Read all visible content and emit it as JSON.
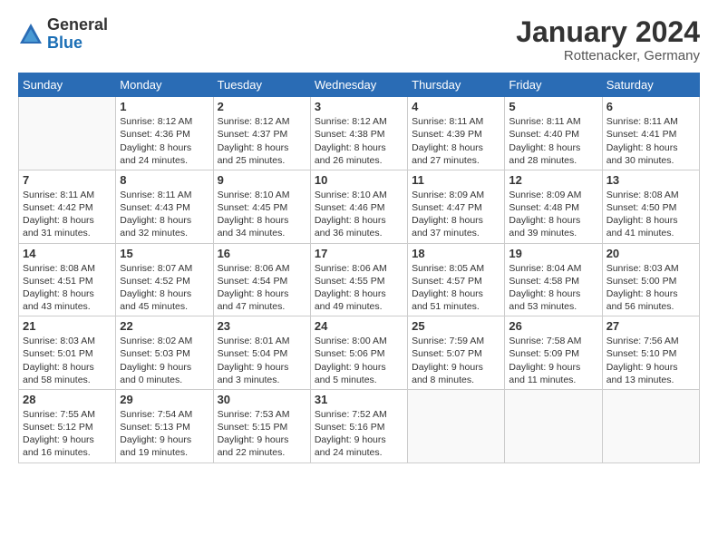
{
  "logo": {
    "general": "General",
    "blue": "Blue"
  },
  "header": {
    "month": "January 2024",
    "location": "Rottenacker, Germany"
  },
  "weekdays": [
    "Sunday",
    "Monday",
    "Tuesday",
    "Wednesday",
    "Thursday",
    "Friday",
    "Saturday"
  ],
  "weeks": [
    [
      {
        "day": "",
        "info": ""
      },
      {
        "day": "1",
        "info": "Sunrise: 8:12 AM\nSunset: 4:36 PM\nDaylight: 8 hours\nand 24 minutes."
      },
      {
        "day": "2",
        "info": "Sunrise: 8:12 AM\nSunset: 4:37 PM\nDaylight: 8 hours\nand 25 minutes."
      },
      {
        "day": "3",
        "info": "Sunrise: 8:12 AM\nSunset: 4:38 PM\nDaylight: 8 hours\nand 26 minutes."
      },
      {
        "day": "4",
        "info": "Sunrise: 8:11 AM\nSunset: 4:39 PM\nDaylight: 8 hours\nand 27 minutes."
      },
      {
        "day": "5",
        "info": "Sunrise: 8:11 AM\nSunset: 4:40 PM\nDaylight: 8 hours\nand 28 minutes."
      },
      {
        "day": "6",
        "info": "Sunrise: 8:11 AM\nSunset: 4:41 PM\nDaylight: 8 hours\nand 30 minutes."
      }
    ],
    [
      {
        "day": "7",
        "info": "Sunrise: 8:11 AM\nSunset: 4:42 PM\nDaylight: 8 hours\nand 31 minutes."
      },
      {
        "day": "8",
        "info": "Sunrise: 8:11 AM\nSunset: 4:43 PM\nDaylight: 8 hours\nand 32 minutes."
      },
      {
        "day": "9",
        "info": "Sunrise: 8:10 AM\nSunset: 4:45 PM\nDaylight: 8 hours\nand 34 minutes."
      },
      {
        "day": "10",
        "info": "Sunrise: 8:10 AM\nSunset: 4:46 PM\nDaylight: 8 hours\nand 36 minutes."
      },
      {
        "day": "11",
        "info": "Sunrise: 8:09 AM\nSunset: 4:47 PM\nDaylight: 8 hours\nand 37 minutes."
      },
      {
        "day": "12",
        "info": "Sunrise: 8:09 AM\nSunset: 4:48 PM\nDaylight: 8 hours\nand 39 minutes."
      },
      {
        "day": "13",
        "info": "Sunrise: 8:08 AM\nSunset: 4:50 PM\nDaylight: 8 hours\nand 41 minutes."
      }
    ],
    [
      {
        "day": "14",
        "info": "Sunrise: 8:08 AM\nSunset: 4:51 PM\nDaylight: 8 hours\nand 43 minutes."
      },
      {
        "day": "15",
        "info": "Sunrise: 8:07 AM\nSunset: 4:52 PM\nDaylight: 8 hours\nand 45 minutes."
      },
      {
        "day": "16",
        "info": "Sunrise: 8:06 AM\nSunset: 4:54 PM\nDaylight: 8 hours\nand 47 minutes."
      },
      {
        "day": "17",
        "info": "Sunrise: 8:06 AM\nSunset: 4:55 PM\nDaylight: 8 hours\nand 49 minutes."
      },
      {
        "day": "18",
        "info": "Sunrise: 8:05 AM\nSunset: 4:57 PM\nDaylight: 8 hours\nand 51 minutes."
      },
      {
        "day": "19",
        "info": "Sunrise: 8:04 AM\nSunset: 4:58 PM\nDaylight: 8 hours\nand 53 minutes."
      },
      {
        "day": "20",
        "info": "Sunrise: 8:03 AM\nSunset: 5:00 PM\nDaylight: 8 hours\nand 56 minutes."
      }
    ],
    [
      {
        "day": "21",
        "info": "Sunrise: 8:03 AM\nSunset: 5:01 PM\nDaylight: 8 hours\nand 58 minutes."
      },
      {
        "day": "22",
        "info": "Sunrise: 8:02 AM\nSunset: 5:03 PM\nDaylight: 9 hours\nand 0 minutes."
      },
      {
        "day": "23",
        "info": "Sunrise: 8:01 AM\nSunset: 5:04 PM\nDaylight: 9 hours\nand 3 minutes."
      },
      {
        "day": "24",
        "info": "Sunrise: 8:00 AM\nSunset: 5:06 PM\nDaylight: 9 hours\nand 5 minutes."
      },
      {
        "day": "25",
        "info": "Sunrise: 7:59 AM\nSunset: 5:07 PM\nDaylight: 9 hours\nand 8 minutes."
      },
      {
        "day": "26",
        "info": "Sunrise: 7:58 AM\nSunset: 5:09 PM\nDaylight: 9 hours\nand 11 minutes."
      },
      {
        "day": "27",
        "info": "Sunrise: 7:56 AM\nSunset: 5:10 PM\nDaylight: 9 hours\nand 13 minutes."
      }
    ],
    [
      {
        "day": "28",
        "info": "Sunrise: 7:55 AM\nSunset: 5:12 PM\nDaylight: 9 hours\nand 16 minutes."
      },
      {
        "day": "29",
        "info": "Sunrise: 7:54 AM\nSunset: 5:13 PM\nDaylight: 9 hours\nand 19 minutes."
      },
      {
        "day": "30",
        "info": "Sunrise: 7:53 AM\nSunset: 5:15 PM\nDaylight: 9 hours\nand 22 minutes."
      },
      {
        "day": "31",
        "info": "Sunrise: 7:52 AM\nSunset: 5:16 PM\nDaylight: 9 hours\nand 24 minutes."
      },
      {
        "day": "",
        "info": ""
      },
      {
        "day": "",
        "info": ""
      },
      {
        "day": "",
        "info": ""
      }
    ]
  ]
}
